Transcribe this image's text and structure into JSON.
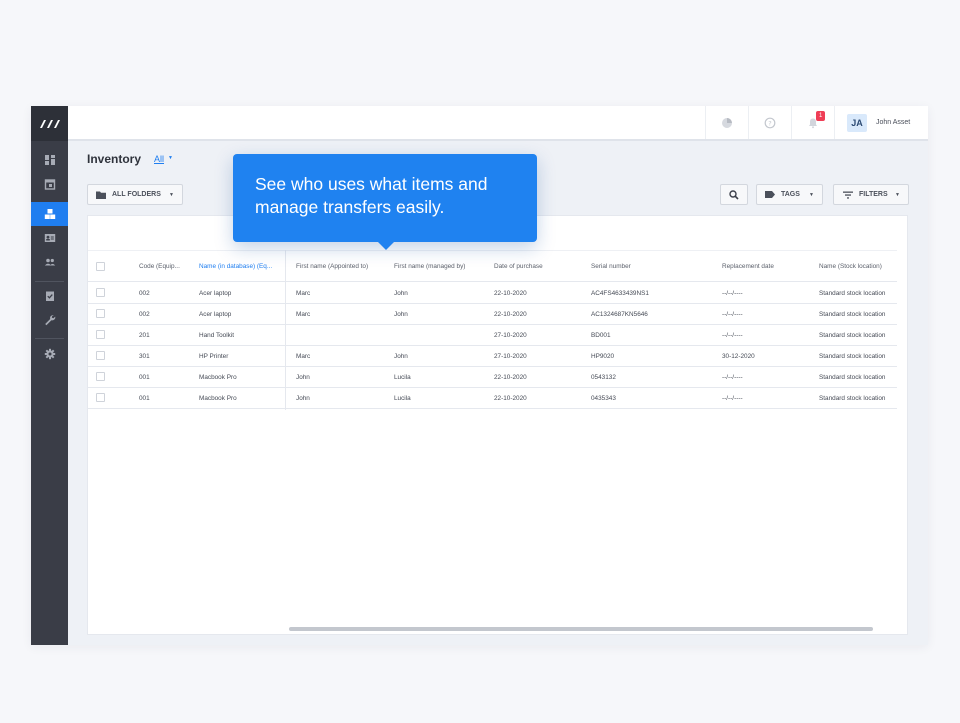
{
  "topbar": {
    "notifications_count": "1",
    "user_initials": "JA",
    "user_name": "John Asset"
  },
  "page": {
    "title": "Inventory",
    "filter_label": "All"
  },
  "toolbar": {
    "folders_label": "ALL FOLDERS",
    "tags_label": "TAGS",
    "filters_label": "FILTERS"
  },
  "tooltip": {
    "line1": "See who uses what items and",
    "line2": "manage transfers easily."
  },
  "table": {
    "headers": [
      "Code (Equip...",
      "Name (in database) (Eq...",
      "First name (Appointed to)",
      "First name (managed by)",
      "Date of purchase",
      "Serial number",
      "Replacement date",
      "Name (Stock location)"
    ],
    "rows": [
      [
        "002",
        "Acer laptop",
        "Marc",
        "John",
        "22-10-2020",
        "AC4FS4633439NS1",
        "--/--/----",
        "Standard stock location"
      ],
      [
        "002",
        "Acer laptop",
        "Marc",
        "John",
        "22-10-2020",
        "AC1324687KN5646",
        "--/--/----",
        "Standard stock location"
      ],
      [
        "201",
        "Hand Toolkit",
        "",
        "",
        "27-10-2020",
        "BD001",
        "--/--/----",
        "Standard stock location"
      ],
      [
        "301",
        "HP Printer",
        "Marc",
        "John",
        "27-10-2020",
        "HP9020",
        "30-12-2020",
        "Standard stock location"
      ],
      [
        "001",
        "Macbook Pro",
        "John",
        "Lucila",
        "22-10-2020",
        "0543132",
        "--/--/----",
        "Standard stock location"
      ],
      [
        "001",
        "Macbook Pro",
        "John",
        "Lucila",
        "22-10-2020",
        "0435343",
        "--/--/----",
        "Standard stock location"
      ]
    ]
  },
  "colors": {
    "accent": "#1f7ef0",
    "sidebar": "#3a3d47",
    "badge": "#ef3e56"
  }
}
